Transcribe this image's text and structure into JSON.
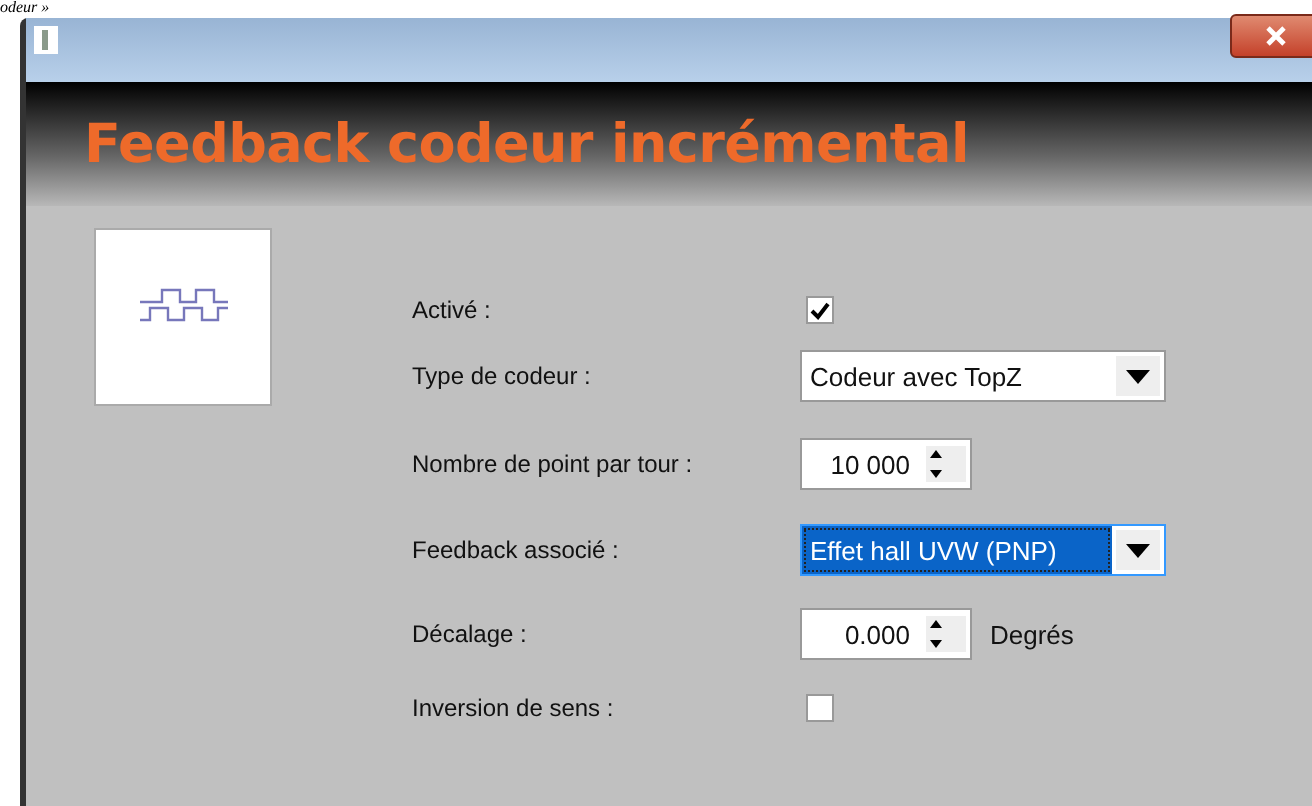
{
  "caption": "odeur »",
  "window": {
    "title": "Feedback codeur incrémental"
  },
  "fields": [
    {
      "kind": "checkbox",
      "label": "Activé :",
      "checked": true
    },
    {
      "kind": "dropdown",
      "label": "Type de codeur :",
      "value": "Codeur avec TopZ",
      "focused": false
    },
    {
      "kind": "spinner",
      "label": "Nombre de point par tour :",
      "value": "10 000"
    },
    {
      "kind": "dropdown",
      "label": "Feedback associé :",
      "value": "Effet hall UVW (PNP)",
      "focused": true
    },
    {
      "kind": "spinner",
      "label": "Décalage :",
      "value": "0.000",
      "unit": "Degrés"
    },
    {
      "kind": "checkbox",
      "label": "Inversion de sens :",
      "checked": false
    }
  ]
}
